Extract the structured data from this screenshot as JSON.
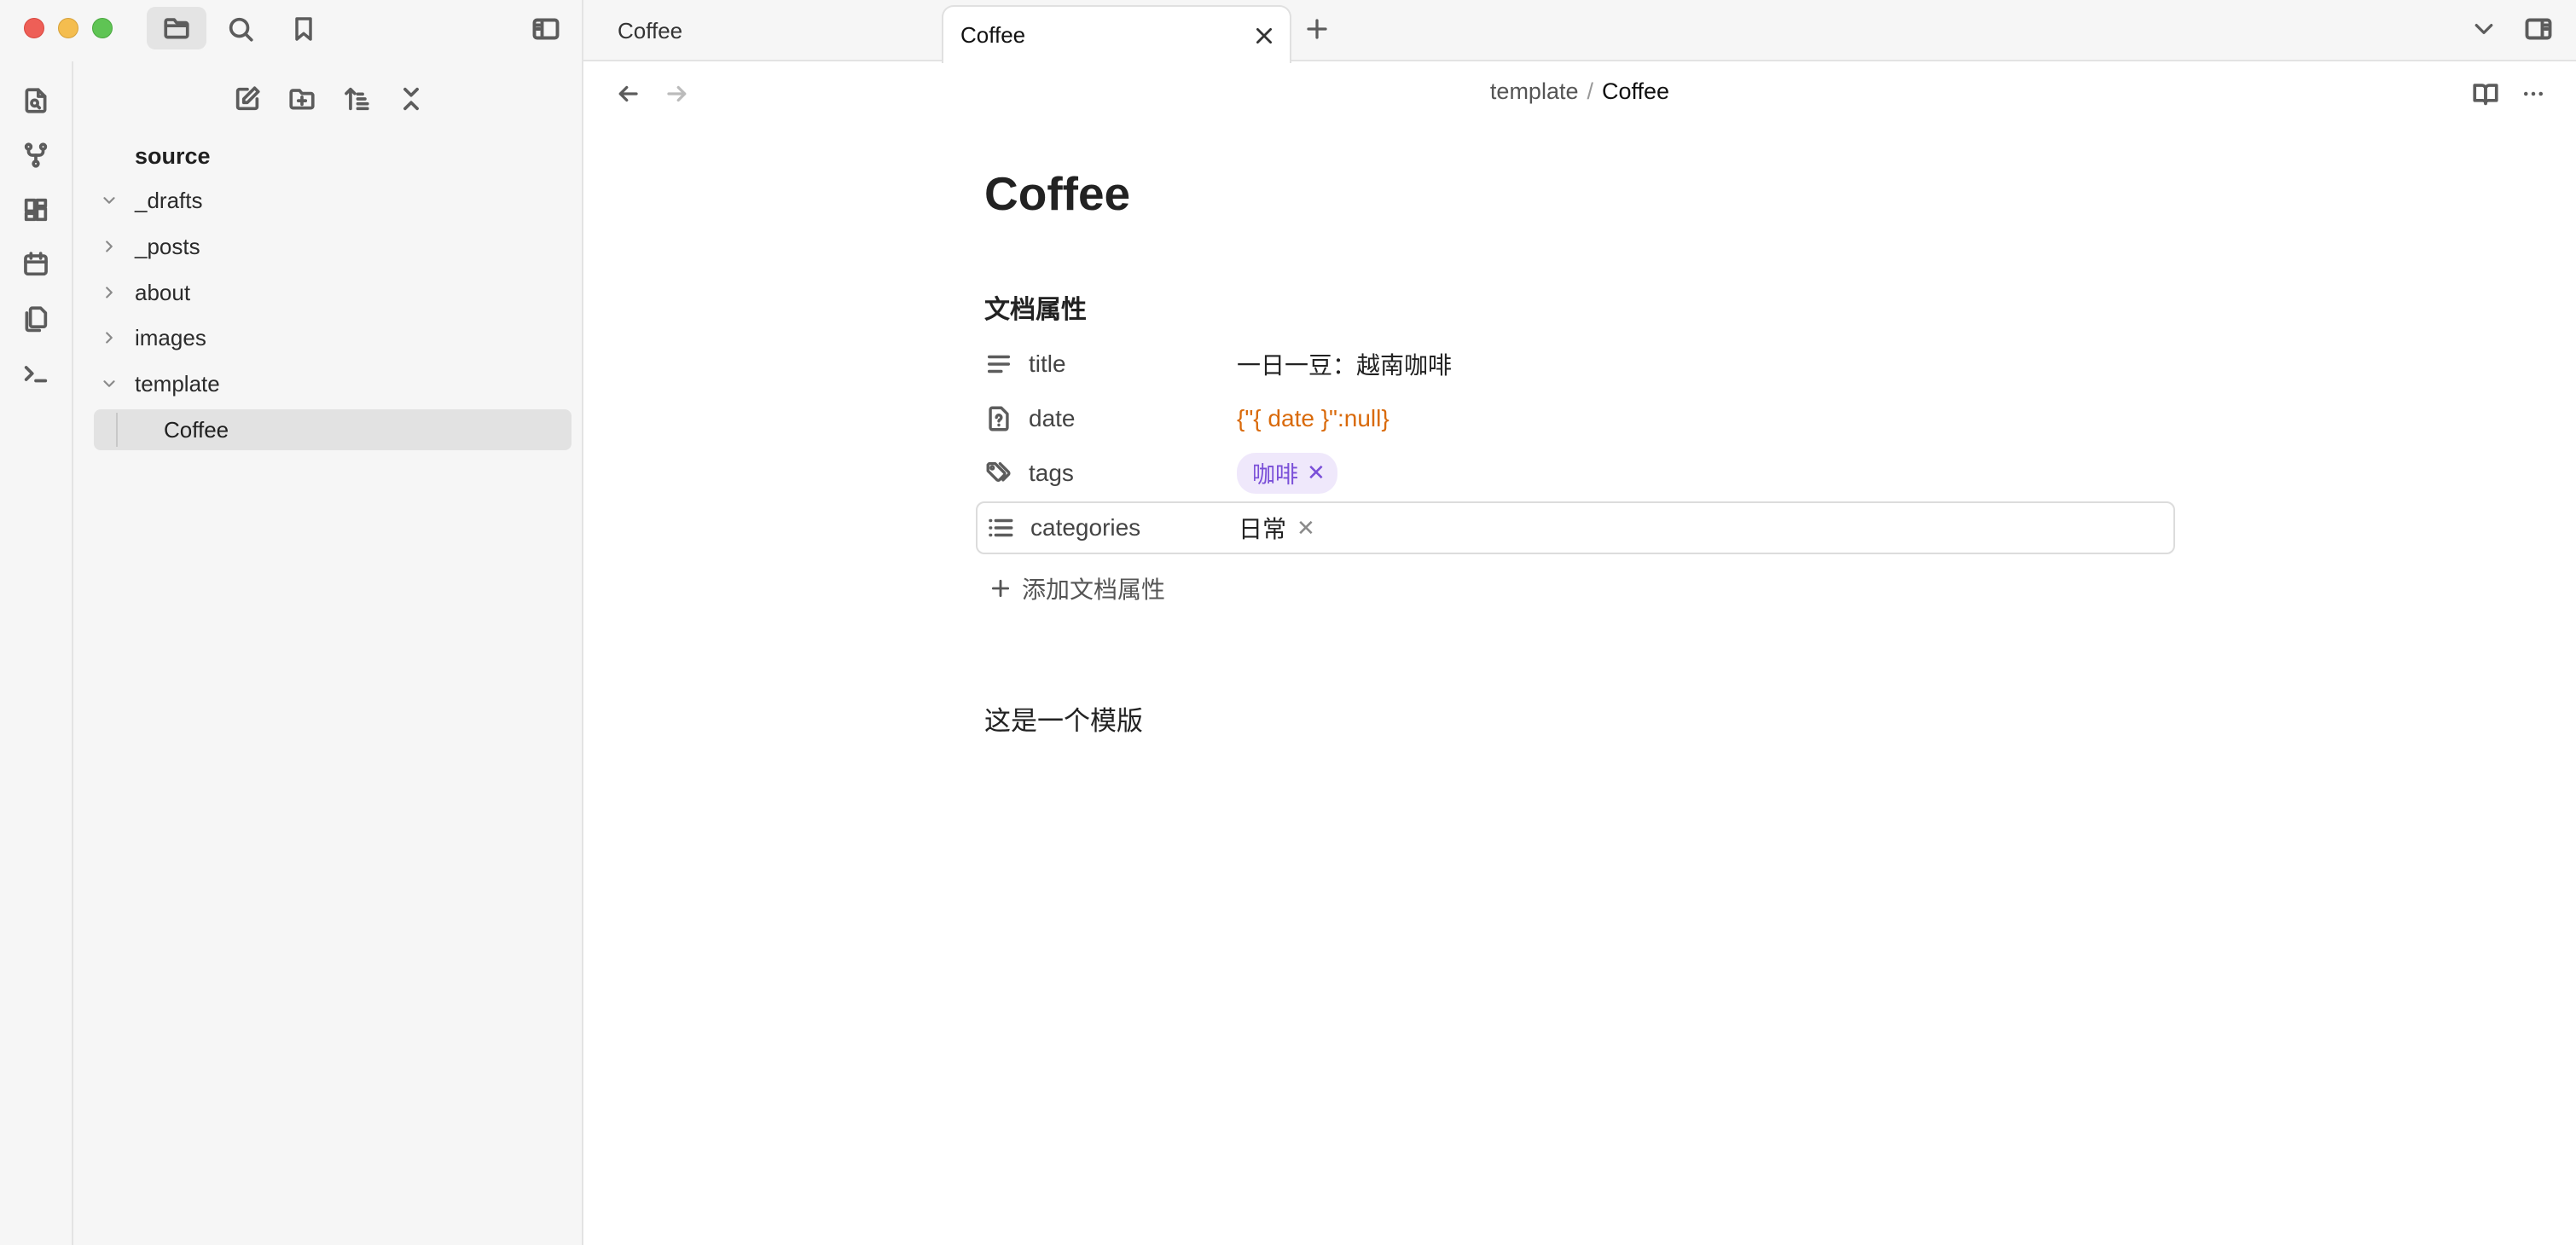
{
  "sidebar": {
    "tree_root": "source",
    "folders": [
      {
        "label": "_drafts",
        "expanded": true
      },
      {
        "label": "_posts",
        "expanded": false
      },
      {
        "label": "about",
        "expanded": false
      },
      {
        "label": "images",
        "expanded": false
      },
      {
        "label": "template",
        "expanded": true
      }
    ],
    "active_file": "Coffee"
  },
  "tabs": [
    {
      "label": "Coffee",
      "active": false
    },
    {
      "label": "Coffee",
      "active": true
    }
  ],
  "breadcrumb": {
    "folder": "template",
    "separator": "/",
    "file": "Coffee"
  },
  "document": {
    "title": "Coffee",
    "properties_heading": "文档属性",
    "properties": [
      {
        "key": "title",
        "value": "一日一豆：越南咖啡",
        "icon": "text-lines-icon"
      },
      {
        "key": "date",
        "value": "{\"{ date }\":null}",
        "icon": "file-question-icon"
      },
      {
        "key": "tags",
        "value": "咖啡",
        "icon": "tags-icon"
      },
      {
        "key": "categories",
        "value": "日常",
        "icon": "list-icon"
      }
    ],
    "add_property_label": "添加文档属性",
    "body": "这是一个模版"
  },
  "colors": {
    "tag_bg": "#efe8fb",
    "tag_text": "#7a4fd8",
    "warning_text": "#d96a0b"
  }
}
